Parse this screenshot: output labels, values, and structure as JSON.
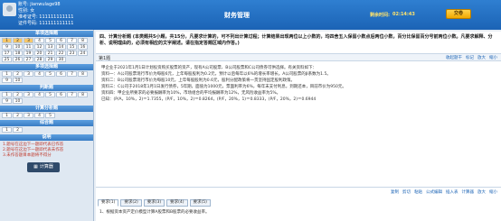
{
  "header": {
    "user_name": "账号: jianwulage98",
    "gender": "性别: 女",
    "exam_no": "准考证号: 111111111111",
    "id_no": "证件号码: 111111111111",
    "title": "财务管理",
    "timer_label": "剩余时间:",
    "timer": "02:14:43",
    "submit_label": "交卷"
  },
  "sidebar": {
    "sections": [
      {
        "title": "单项选择题",
        "numbers": [
          "1",
          "2",
          "3",
          "4",
          "5",
          "6",
          "7",
          "8",
          "9",
          "10",
          "11",
          "12",
          "13",
          "14",
          "15",
          "16",
          "17",
          "18",
          "19",
          "20",
          "21",
          "22",
          "23",
          "24",
          "25",
          "26",
          "27",
          "28",
          "29",
          "30"
        ]
      },
      {
        "title": "多项选择题",
        "numbers": [
          "1",
          "2",
          "3",
          "4",
          "5",
          "6",
          "7",
          "8",
          "9",
          "10"
        ]
      },
      {
        "title": "判断题",
        "numbers": [
          "1",
          "2",
          "3",
          "4",
          "5",
          "6",
          "7",
          "8",
          "9",
          "10"
        ]
      },
      {
        "title": "计算分析题",
        "numbers": [
          "1",
          "2",
          "3",
          "4",
          "5"
        ]
      },
      {
        "title": "综合题",
        "numbers": [
          "1",
          "2"
        ]
      }
    ],
    "notes_title": "说明",
    "notes": [
      "1.题号在这边下一题即代表已作答",
      "2.题号在这边下一题即代表未作答",
      "3.未作答题目本题将不得分"
    ],
    "calc_label": "计算器"
  },
  "main": {
    "question_head": "四、计算分析题 (本类题共5小题，共15分，凡要求计算的，可不列出计算过程；计算结果出现两位以上小数的，均四舍五入保留小数点后两位小数，百分比保留百分号前两位小数。凡要求解释、分析、说明理由的，必须有相应的文字阐述。请在指定答题区域内作答。)",
    "sub_no": "第1题",
    "tools": [
      "收起题干",
      "标记",
      "放大",
      "缩小"
    ],
    "content": [
      "甲企业于2021年1月1日计划投资购买股票的资产，现有A公司股票、B公司股票和C公司债券可供选择。有关资料如下：",
      "资料一：A公司股票现行市价为每股6元，上年每股股利为0.2元，预计以后每年以6%的增长率增长。A公司股票的β系数为1.5。",
      "资料二：B公司股票现行市价为每股10元，上年每股股利为0.6元，股利分配政策将一贯坚持固定股利政策。",
      "资料三：C公司于2018年1月1日发行债券，5年期，面值为1000元，票面利率为6%，每年末支付利息，到期还本，目前市价为950元。",
      "资料四：甲企业所要求的必要报酬率为10%，市场组合的平均报酬率为12%，无风险收益率为5%。",
      "已知：(P/A，10%，2)＝1.7355，(P/F，10%，2)＝0.8264，(P/F，20%，1)＝0.8333，(P/F，20%，2)＝0.6944"
    ],
    "bottom_tools": [
      "复制",
      "剪切",
      "粘贴",
      "公式编辑",
      "插入表",
      "计算器",
      "放大",
      "缩小"
    ],
    "req_tabs": [
      "要求(1)",
      "要求(2)",
      "要求(3)",
      "要求(4)",
      "要求(5)"
    ],
    "req_text": "1、根据资本资产定价模型计算A股票和B股票的必要收益率。"
  }
}
